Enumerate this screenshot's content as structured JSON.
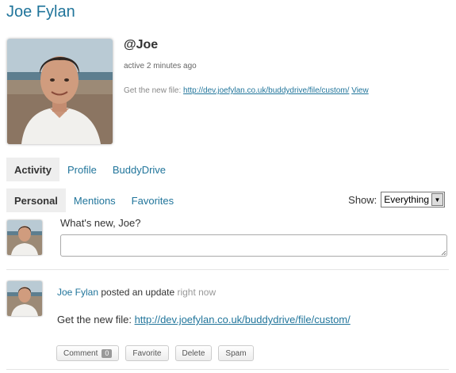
{
  "profile": {
    "name": "Joe Fylan",
    "mention": "@Joe",
    "active": "active 2 minutes ago",
    "latest_update": {
      "prefix": "Get the new file: ",
      "link": "http://dev.joefylan.co.uk/buddydrive/file/custom/",
      "view_label": "View"
    }
  },
  "main_nav": {
    "tabs": [
      "Activity",
      "Profile",
      "BuddyDrive"
    ],
    "current": "Activity"
  },
  "sub_nav": {
    "tabs": [
      "Personal",
      "Mentions",
      "Favorites"
    ],
    "current": "Personal"
  },
  "filter": {
    "label": "Show:",
    "selected": "Everything"
  },
  "post_form": {
    "label": "What's new, Joe?",
    "value": ""
  },
  "activity": {
    "author": "Joe Fylan",
    "action": " posted an update ",
    "time": "right now",
    "body_prefix": "Get the new file: ",
    "body_link": "http://dev.joefylan.co.uk/buddydrive/file/custom/",
    "buttons": {
      "comment": "Comment",
      "comment_count": "0",
      "favorite": "Favorite",
      "delete": "Delete",
      "spam": "Spam"
    }
  }
}
